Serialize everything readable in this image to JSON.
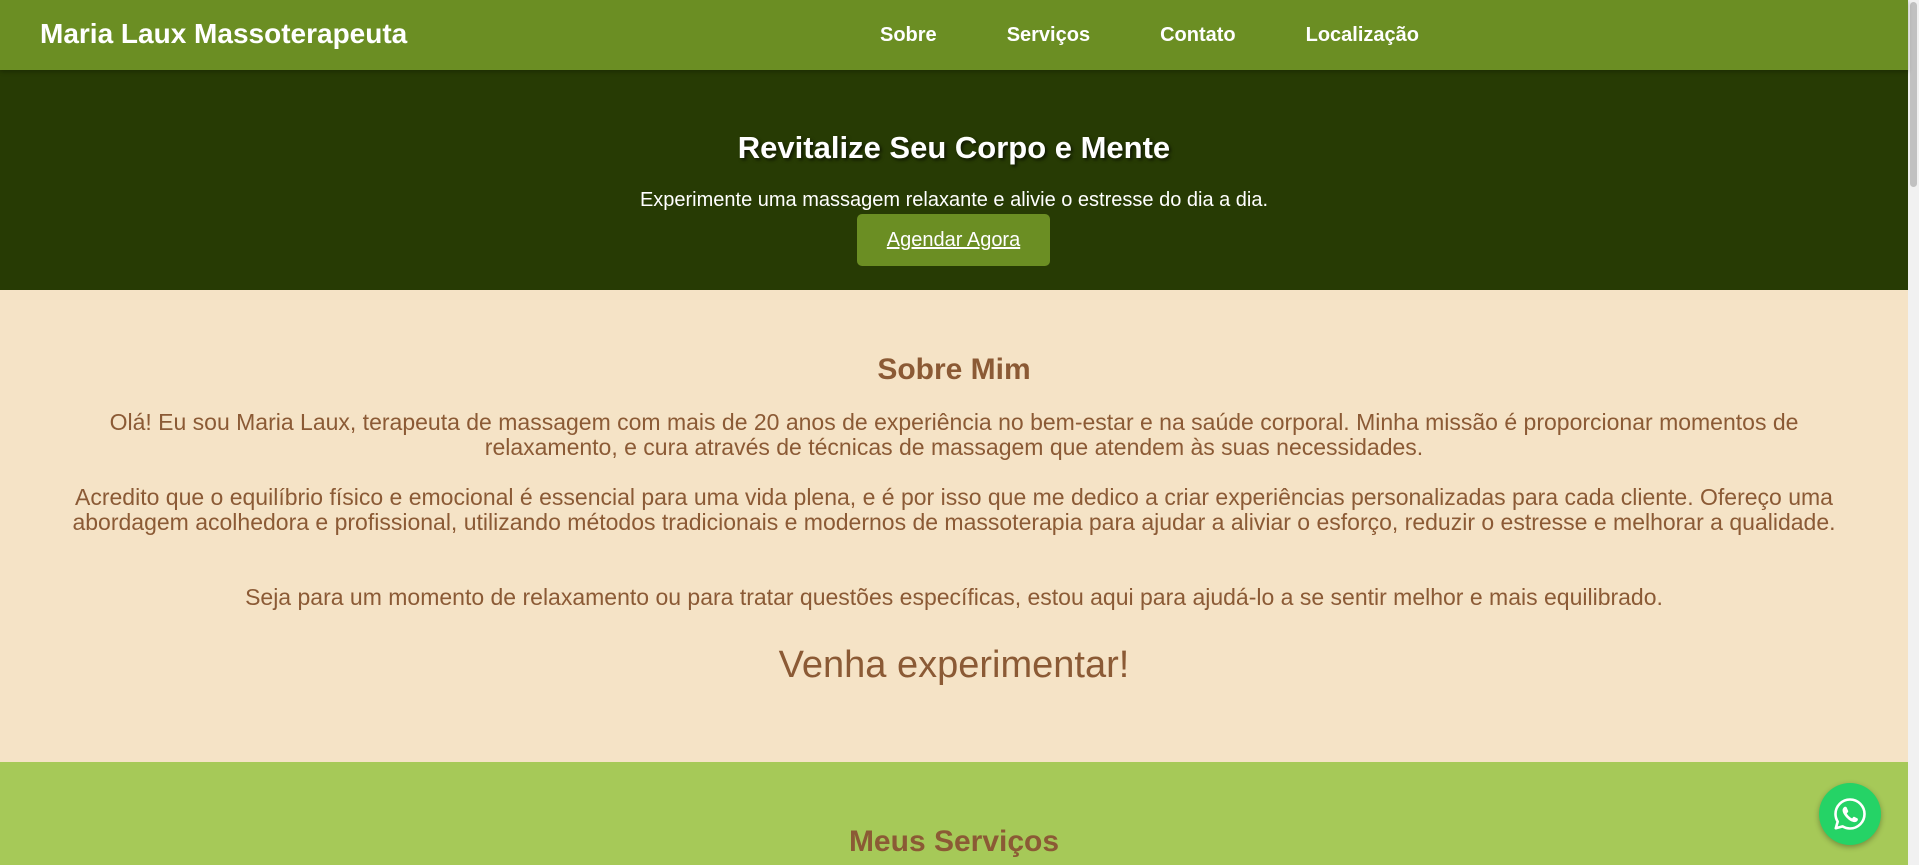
{
  "header": {
    "brand": "Maria Laux Massoterapeuta",
    "nav": [
      "Sobre",
      "Serviços",
      "Contato",
      "Localização"
    ]
  },
  "hero": {
    "title": "Revitalize Seu Corpo e Mente",
    "subtitle": "Experimente uma massagem relaxante e alivie o estresse do dia a dia.",
    "button_label": "Agendar Agora"
  },
  "about": {
    "title": "Sobre Mim",
    "p1": "Olá! Eu sou Maria Laux, terapeuta de massagem com mais de 20 anos de experiência no bem-estar e na saúde corporal. Minha missão é proporcionar momentos de relaxamento, e cura através de técnicas de massagem que atendem às suas necessidades.",
    "p2": "Acredito que o equilíbrio físico e emocional é essencial para uma vida plena, e é por isso que me dedico a criar experiências personalizadas para cada cliente. Ofereço uma abordagem acolhedora e profissional, utilizando métodos tradicionais e modernos de massoterapia para ajudar a aliviar o esforço, reduzir o estresse e melhorar a qualidade.",
    "p3": "Seja para um momento de relaxamento ou para tratar questões específicas, estou aqui para ajudá-lo a se sentir melhor e mais equilibrado.",
    "cta": "Venha experimentar!"
  },
  "services": {
    "title": "Meus Serviços"
  },
  "floating": {
    "icon": "whatsapp-icon"
  },
  "colors": {
    "header_bg": "#6b8e23",
    "hero_bg": "#273b04",
    "about_bg": "#f5e3c6",
    "services_bg": "#a6c958",
    "text_brown": "#8b5a35",
    "whatsapp_green": "#25d366"
  }
}
